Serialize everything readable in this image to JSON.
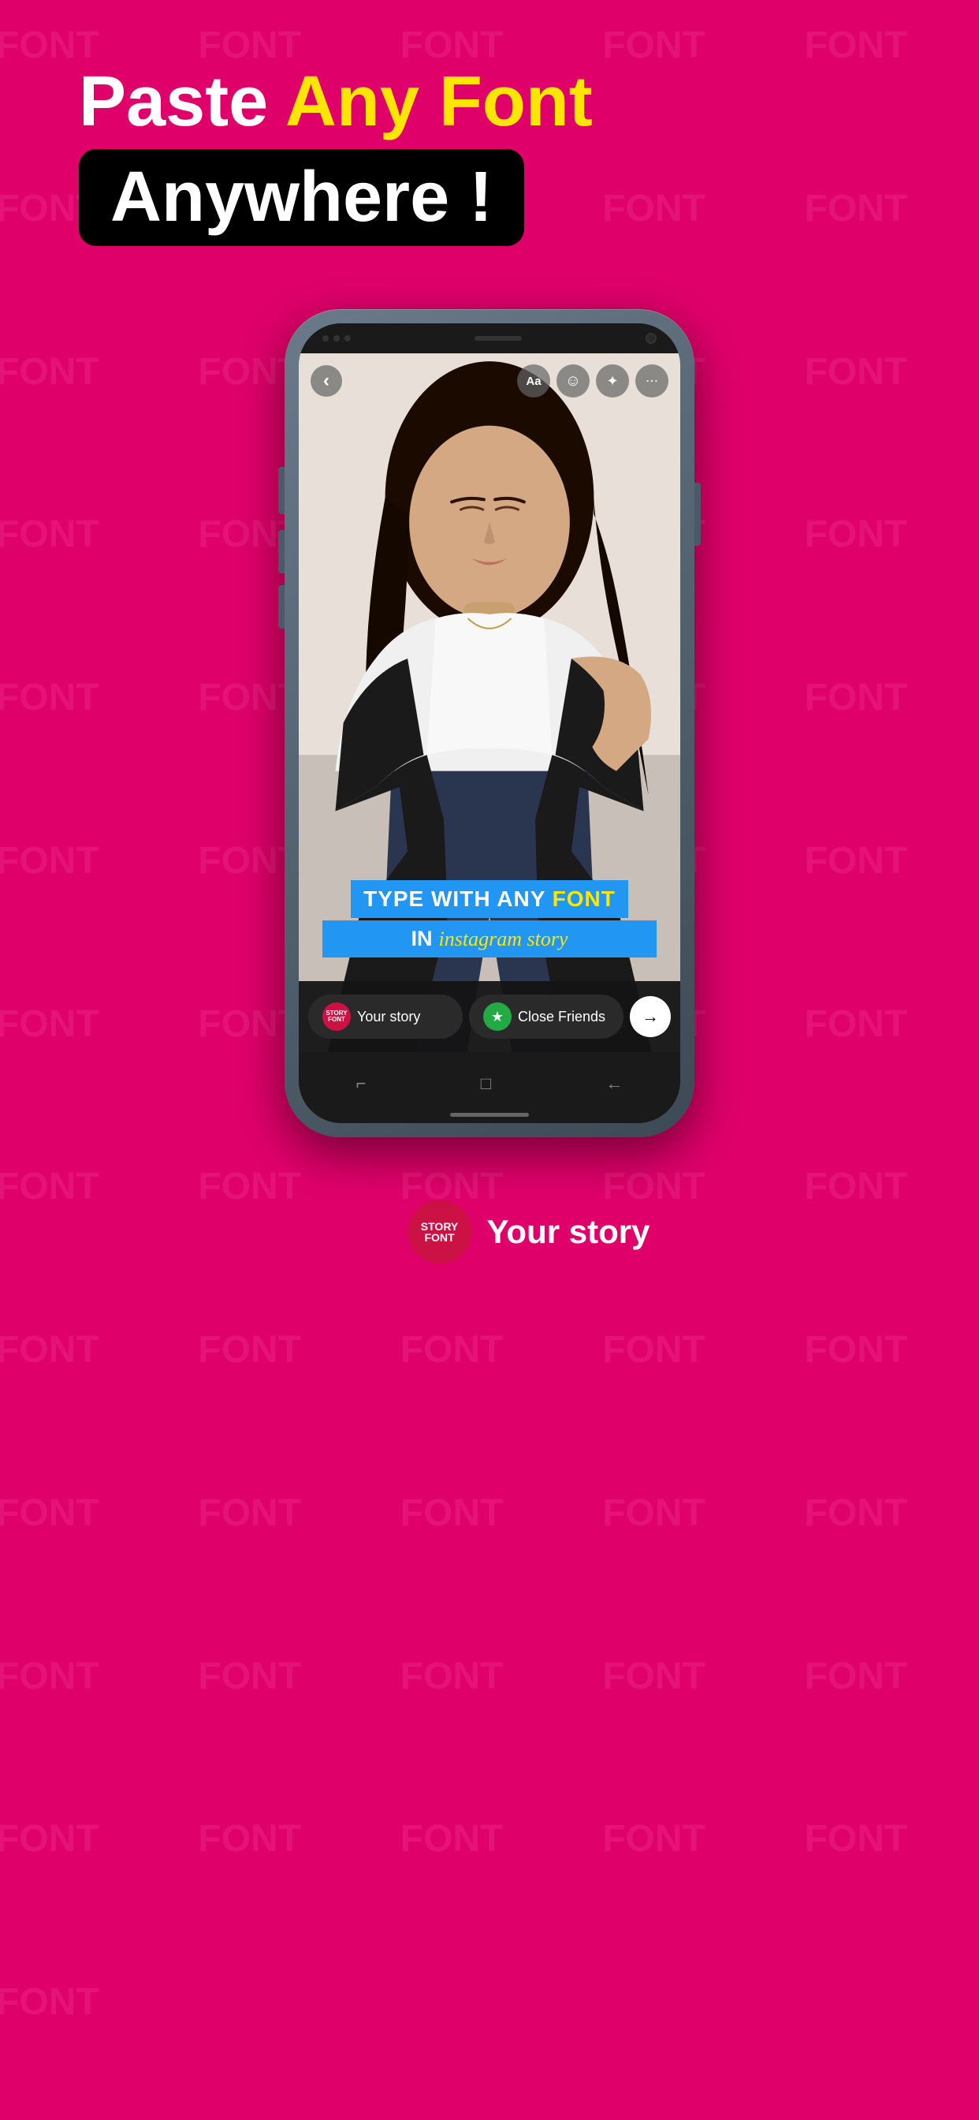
{
  "background_color": "#E0006A",
  "watermark": {
    "text": "FONT",
    "color": "#ff69b4"
  },
  "header": {
    "line1_word1": "Paste",
    "line1_word2": "Any Font",
    "line2": "Anywhere !",
    "line1_word1_color": "#ffffff",
    "line1_word2_color": "#FFE600",
    "line2_color": "#ffffff",
    "line2_bg": "#000000"
  },
  "phone": {
    "story_toolbar": {
      "back_icon": "‹",
      "text_icon": "Aa",
      "sticker_icon": "☺",
      "effects_icon": "✦",
      "more_icon": "⋯"
    },
    "story_overlay": {
      "line1_part1": "TYPE WITH ANY ",
      "line1_highlight": "FONT",
      "line2_in": "IN",
      "line2_italic": "instagram story"
    },
    "bottom_bar": {
      "your_story_label": "Your story",
      "close_friends_label": "Close Friends",
      "share_icon": "→"
    },
    "nav": {
      "back_icon": "⌐",
      "home_icon": "□",
      "recent_icon": "←"
    }
  },
  "bottom_section": {
    "label": "STORY FONT",
    "sublabel": "Your story"
  }
}
